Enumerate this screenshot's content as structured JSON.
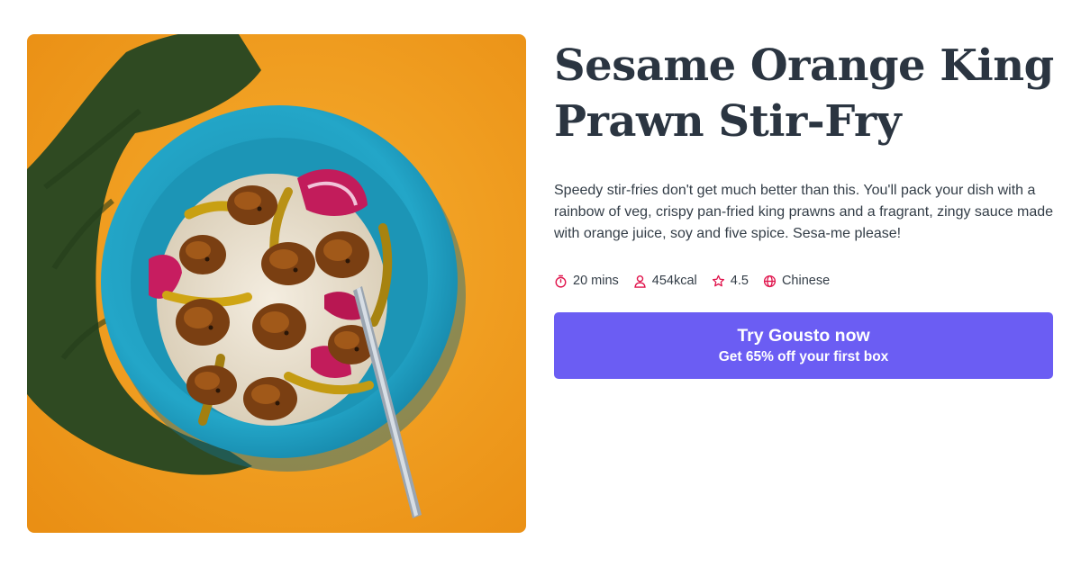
{
  "recipe": {
    "title": "Sesame Orange King Prawn Stir-Fry",
    "description": "Speedy stir-fries don't get much better than this. You'll pack your dish with a rainbow of veg, crispy pan-fried king prawns and a fragrant, zingy sauce made with orange juice, soy and five spice. Sesa-me please!",
    "meta": {
      "time": "20 mins",
      "calories": "454kcal",
      "rating": "4.5",
      "cuisine": "Chinese"
    }
  },
  "icons": {
    "time": "stopwatch-icon",
    "calories": "person-icon",
    "rating": "star-icon",
    "cuisine": "globe-icon"
  },
  "cta": {
    "title": "Try Gousto now",
    "subtitle": "Get 65% off your first box"
  },
  "colors": {
    "title": "#2b3541",
    "text": "#333d47",
    "icon_accent": "#e0144c",
    "cta_background": "#6b5df3",
    "cta_text": "#ffffff",
    "photo_background": "#f2a126",
    "bowl": "#1d9fbe"
  }
}
